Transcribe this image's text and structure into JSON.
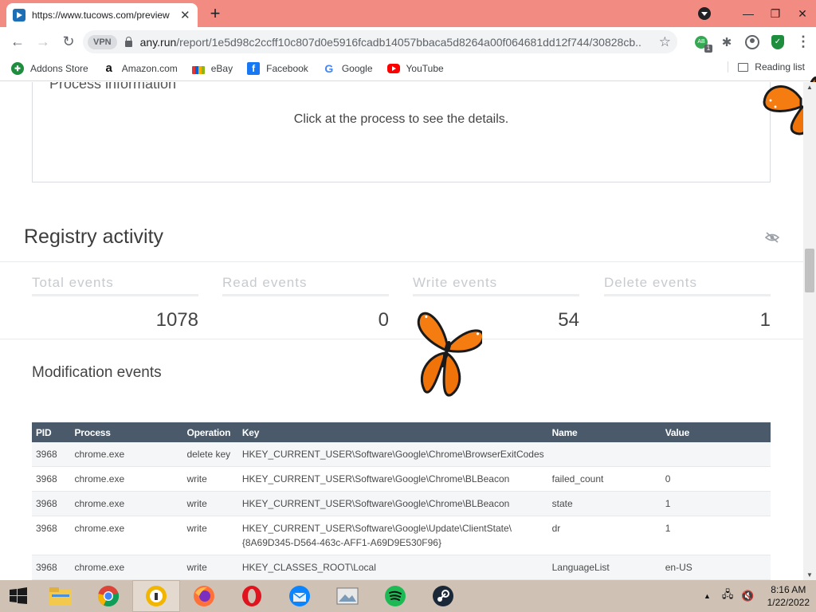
{
  "browser": {
    "tab_title": "https://www.tucows.com/preview",
    "tab_close": "✕",
    "new_tab": "+",
    "window_buttons": [
      "—",
      "❐",
      "✕"
    ],
    "vpn_label": "VPN",
    "url_host": "any.run",
    "url_path": "/report/1e5d98c2ccff10c807d0e5916fcadb14057bbaca5d8264a00f064681dd12f744/30828cb...",
    "ext_badge": "1",
    "ext_ab": "AB"
  },
  "bookmarks": {
    "items": [
      {
        "label": "Addons Store",
        "icon": "addons-icon"
      },
      {
        "label": "Amazon.com",
        "icon": "amazon-icon"
      },
      {
        "label": "eBay",
        "icon": "ebay-icon"
      },
      {
        "label": "Facebook",
        "icon": "facebook-icon"
      },
      {
        "label": "Google",
        "icon": "google-icon"
      },
      {
        "label": "YouTube",
        "icon": "youtube-icon"
      }
    ],
    "reading_list": "Reading list"
  },
  "process_info": {
    "title": "Process information",
    "hint": "Click at the process to see the details."
  },
  "registry": {
    "title": "Registry activity",
    "stats": [
      {
        "label": "Total events",
        "value": "1078"
      },
      {
        "label": "Read events",
        "value": "0"
      },
      {
        "label": "Write events",
        "value": "54"
      },
      {
        "label": "Delete events",
        "value": "1"
      }
    ],
    "modification_title": "Modification events",
    "columns": [
      "PID",
      "Process",
      "Operation",
      "Key",
      "Name",
      "Value"
    ],
    "rows": [
      {
        "pid": "3968",
        "process": "chrome.exe",
        "operation": "delete key",
        "key": "HKEY_CURRENT_USER\\Software\\Google\\Chrome\\BrowserExitCodes",
        "name": "",
        "value": ""
      },
      {
        "pid": "3968",
        "process": "chrome.exe",
        "operation": "write",
        "key": "HKEY_CURRENT_USER\\Software\\Google\\Chrome\\BLBeacon",
        "name": "failed_count",
        "value": "0"
      },
      {
        "pid": "3968",
        "process": "chrome.exe",
        "operation": "write",
        "key": "HKEY_CURRENT_USER\\Software\\Google\\Chrome\\BLBeacon",
        "name": "state",
        "value": "1"
      },
      {
        "pid": "3968",
        "process": "chrome.exe",
        "operation": "write",
        "key": "HKEY_CURRENT_USER\\Software\\Google\\Update\\ClientState\\{8A69D345-D564-463c-AFF1-A69D9E530F96}",
        "name": "dr",
        "value": "1"
      },
      {
        "pid": "3968",
        "process": "chrome.exe",
        "operation": "write",
        "key": "HKEY_CLASSES_ROOT\\Local",
        "name": "LanguageList",
        "value": "en-US"
      }
    ]
  },
  "taskbar": {
    "apps": [
      "file-explorer-icon",
      "chrome-icon",
      "norton-icon",
      "firefox-icon",
      "opera-icon",
      "thunderbird-icon",
      "photo-viewer-icon",
      "spotify-icon",
      "steam-icon"
    ],
    "time": "8:16 AM",
    "date": "1/22/2022"
  },
  "colors": {
    "tab_strip": "#f28b82",
    "table_header": "#4b5a6b",
    "taskbar": "#cfc2b5"
  }
}
